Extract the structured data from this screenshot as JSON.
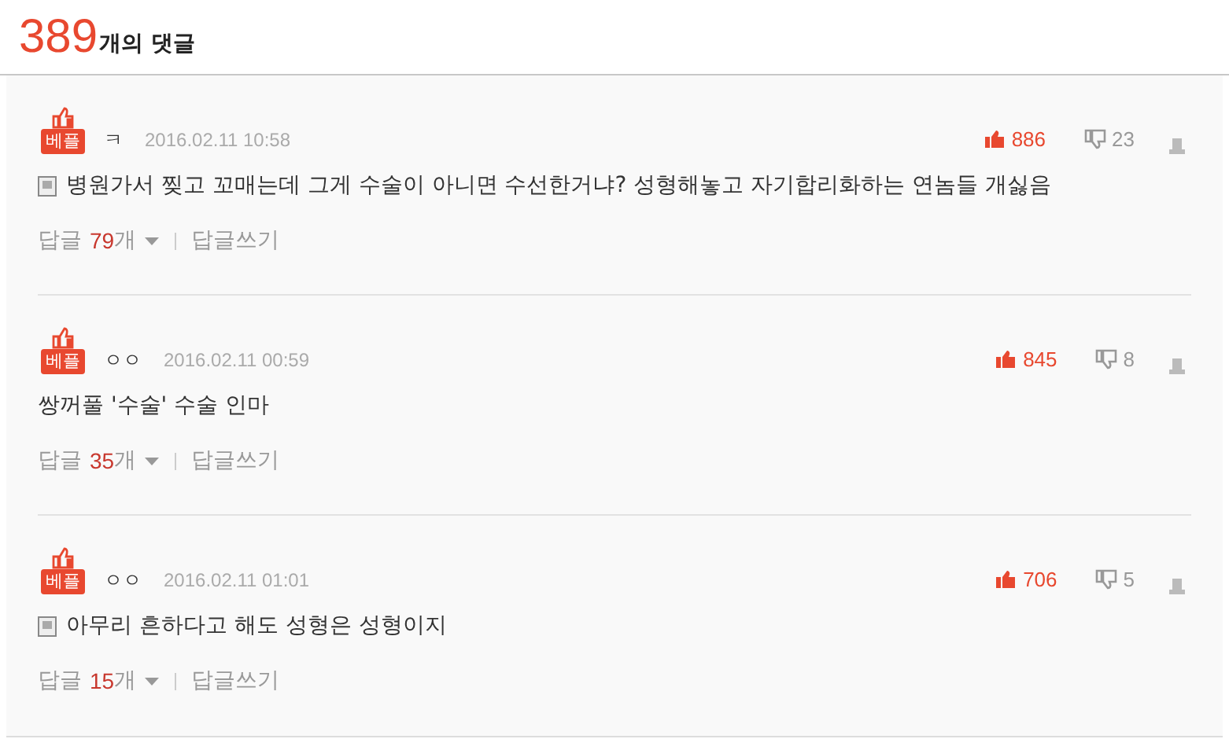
{
  "header": {
    "count": "389",
    "label": "개의 댓글"
  },
  "comments": [
    {
      "badge": "베플",
      "author": "ㅋ",
      "date": "2016.02.11 10:58",
      "likes": "886",
      "dislikes": "23",
      "note_icon": true,
      "text": "병원가서 찢고 꼬매는데 그게 수술이 아니면 수선한거냐? 성형해놓고 자기합리화하는 연놈들 개싫음",
      "reply_label": "답글",
      "reply_count": "79",
      "reply_unit": "개",
      "write_reply": "답글쓰기"
    },
    {
      "badge": "베플",
      "author": "ㅇㅇ",
      "date": "2016.02.11 00:59",
      "likes": "845",
      "dislikes": "8",
      "note_icon": false,
      "text": "쌍꺼풀 '수술' 수술 인마",
      "reply_label": "답글",
      "reply_count": "35",
      "reply_unit": "개",
      "write_reply": "답글쓰기"
    },
    {
      "badge": "베플",
      "author": "ㅇㅇ",
      "date": "2016.02.11 01:01",
      "likes": "706",
      "dislikes": "5",
      "note_icon": true,
      "text": "아무리 흔하다고 해도 성형은 성형이지",
      "reply_label": "답글",
      "reply_count": "15",
      "reply_unit": "개",
      "write_reply": "답글쓰기"
    }
  ]
}
